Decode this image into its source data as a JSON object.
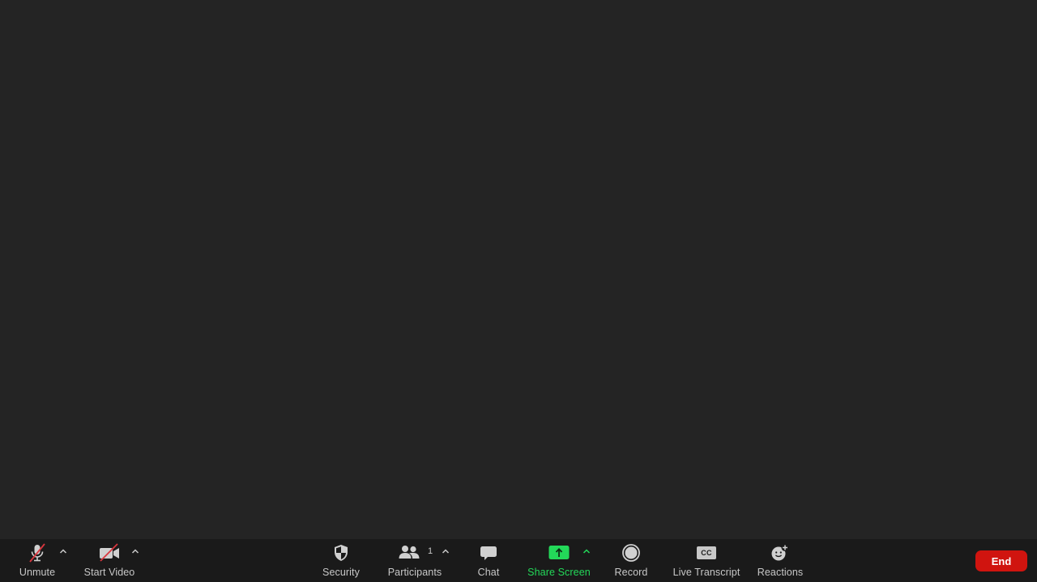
{
  "meeting": {
    "background_color": "#242424"
  },
  "toolbar": {
    "background_color": "#1a1a1a",
    "unmute": {
      "label": "Unmute",
      "icon": "microphone-muted-icon"
    },
    "start_video": {
      "label": "Start Video",
      "icon": "video-camera-off-icon"
    },
    "security": {
      "label": "Security",
      "icon": "shield-icon"
    },
    "participants": {
      "label": "Participants",
      "icon": "people-icon",
      "count": "1"
    },
    "chat": {
      "label": "Chat",
      "icon": "chat-bubble-icon"
    },
    "share_screen": {
      "label": "Share Screen",
      "icon": "share-screen-arrow-up-icon",
      "color": "#23d959"
    },
    "record": {
      "label": "Record",
      "icon": "record-circle-icon"
    },
    "live_transcript": {
      "label": "Live Transcript",
      "icon": "cc-icon",
      "icon_text": "CC"
    },
    "reactions": {
      "label": "Reactions",
      "icon": "smiley-plus-icon"
    },
    "end": {
      "label": "End",
      "color": "#d0140f"
    }
  }
}
